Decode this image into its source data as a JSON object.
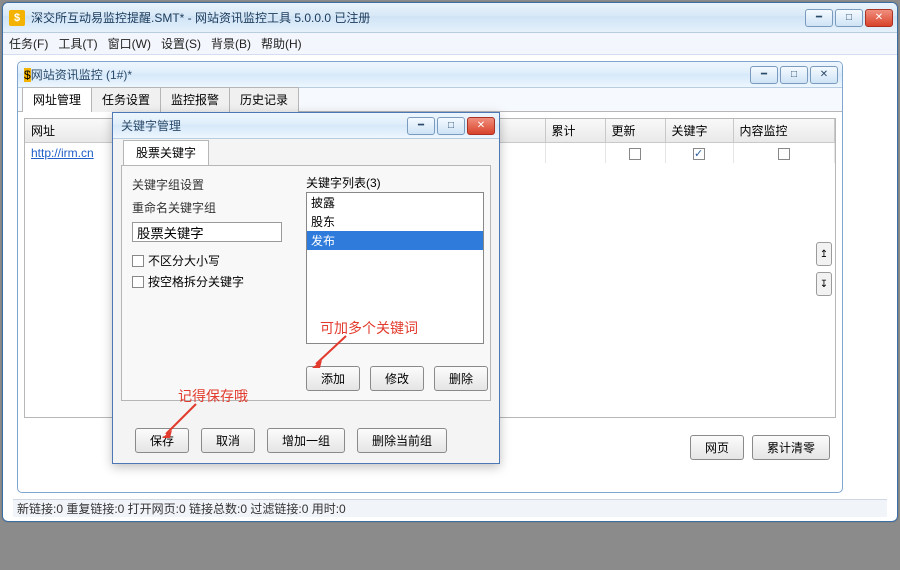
{
  "app": {
    "title": "深交所互动易监控提醒.SMT* - 网站资讯监控工具 5.0.0.0  已注册"
  },
  "menu": {
    "items": [
      "任务(F)",
      "工具(T)",
      "窗口(W)",
      "设置(S)",
      "背景(B)",
      "帮助(H)"
    ]
  },
  "child": {
    "title": "网站资讯监控  (1#)*",
    "tabs": [
      "网址管理",
      "任务设置",
      "监控报警",
      "历史记录"
    ],
    "active_tab": 0,
    "columns": [
      "网址",
      "累计",
      "更新",
      "关键字",
      "内容监控"
    ],
    "rows": [
      {
        "url": "http://irm.cn",
        "update": false,
        "keyword": true,
        "content": false
      }
    ],
    "bottom_buttons": [
      "网页",
      "累计清零"
    ]
  },
  "dialog": {
    "title": "关键字管理",
    "tab": "股票关键字",
    "group_label": "关键字组设置",
    "rename_label": "重命名关键字组",
    "rename_value": "股票关键字",
    "opt_case": "不区分大小写",
    "opt_split": "按空格拆分关键字",
    "list_label": "关键字列表(3)",
    "list_items": [
      "披露",
      "股东",
      "发布"
    ],
    "selected_index": 2,
    "list_btns": [
      "添加",
      "修改",
      "删除"
    ],
    "bottom_btns": [
      "保存",
      "取消",
      "增加一组",
      "删除当前组"
    ]
  },
  "annotations": {
    "a1": "可加多个关键词",
    "a2": "记得保存哦"
  },
  "status": "新链接:0  重复链接:0  打开网页:0  链接总数:0  过滤链接:0  用时:0"
}
